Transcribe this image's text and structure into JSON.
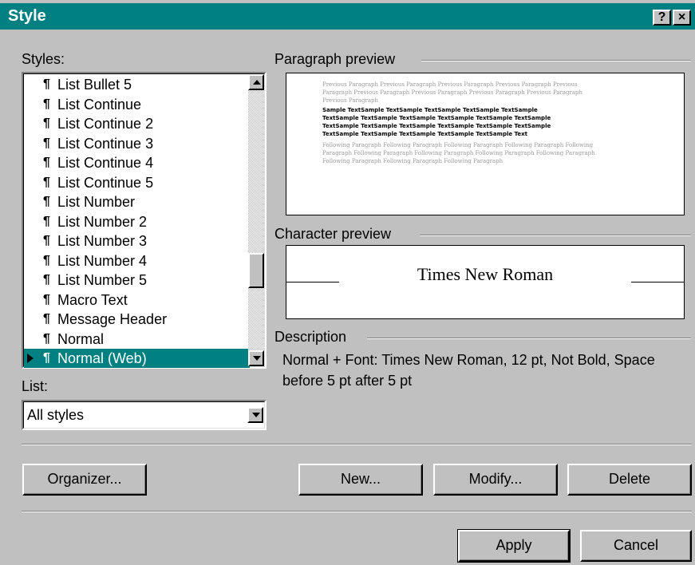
{
  "window": {
    "title": "Style",
    "help_label": "?",
    "close_label": "×"
  },
  "styles_label": "Styles:",
  "styles_list": [
    "List Bullet 5",
    "List Continue",
    "List Continue 2",
    "List Continue 3",
    "List Continue 4",
    "List Continue 5",
    "List Number",
    "List Number 2",
    "List Number 3",
    "List Number 4",
    "List Number 5",
    "Macro Text",
    "Message Header",
    "Normal",
    "Normal (Web)"
  ],
  "styles_selected": "Normal (Web)",
  "pilcrow": "¶",
  "list_label": "List:",
  "list_value": "All styles",
  "paragraph_preview": {
    "label": "Paragraph preview",
    "previous_text": [
      "Previous Paragraph Previous Paragraph Previous Paragraph Previous Paragraph Previous",
      "Paragraph Previous Paragraph Previous Paragraph Previous Paragraph Previous Paragraph",
      "Previous Paragraph"
    ],
    "sample_text": [
      "Sample TextSample TextSample TextSample TextSample TextSample",
      "TextSample TextSample TextSample TextSample TextSample TextSample",
      "TextSample TextSample TextSample TextSample TextSample TextSample",
      "TextSample TextSample TextSample TextSample TextSample Text"
    ],
    "following_text": [
      "Following Paragraph Following Paragraph Following Paragraph Following Paragraph Following",
      "Paragraph Following Paragraph Following Paragraph Following Paragraph Following Paragraph",
      "Following Paragraph Following Paragraph Following Paragraph"
    ]
  },
  "character_preview": {
    "label": "Character preview",
    "text": "Times New Roman"
  },
  "description": {
    "label": "Description",
    "text": "Normal + Font: Times New Roman, 12 pt, Not Bold, Space before 5 pt  after 5 pt"
  },
  "buttons": {
    "organizer": "Organizer...",
    "new": "New...",
    "modify": "Modify...",
    "delete": "Delete",
    "apply": "Apply",
    "cancel": "Cancel"
  },
  "colors": {
    "titlebar": "#008080",
    "selection": "#008080",
    "face": "#c0c0c0"
  }
}
